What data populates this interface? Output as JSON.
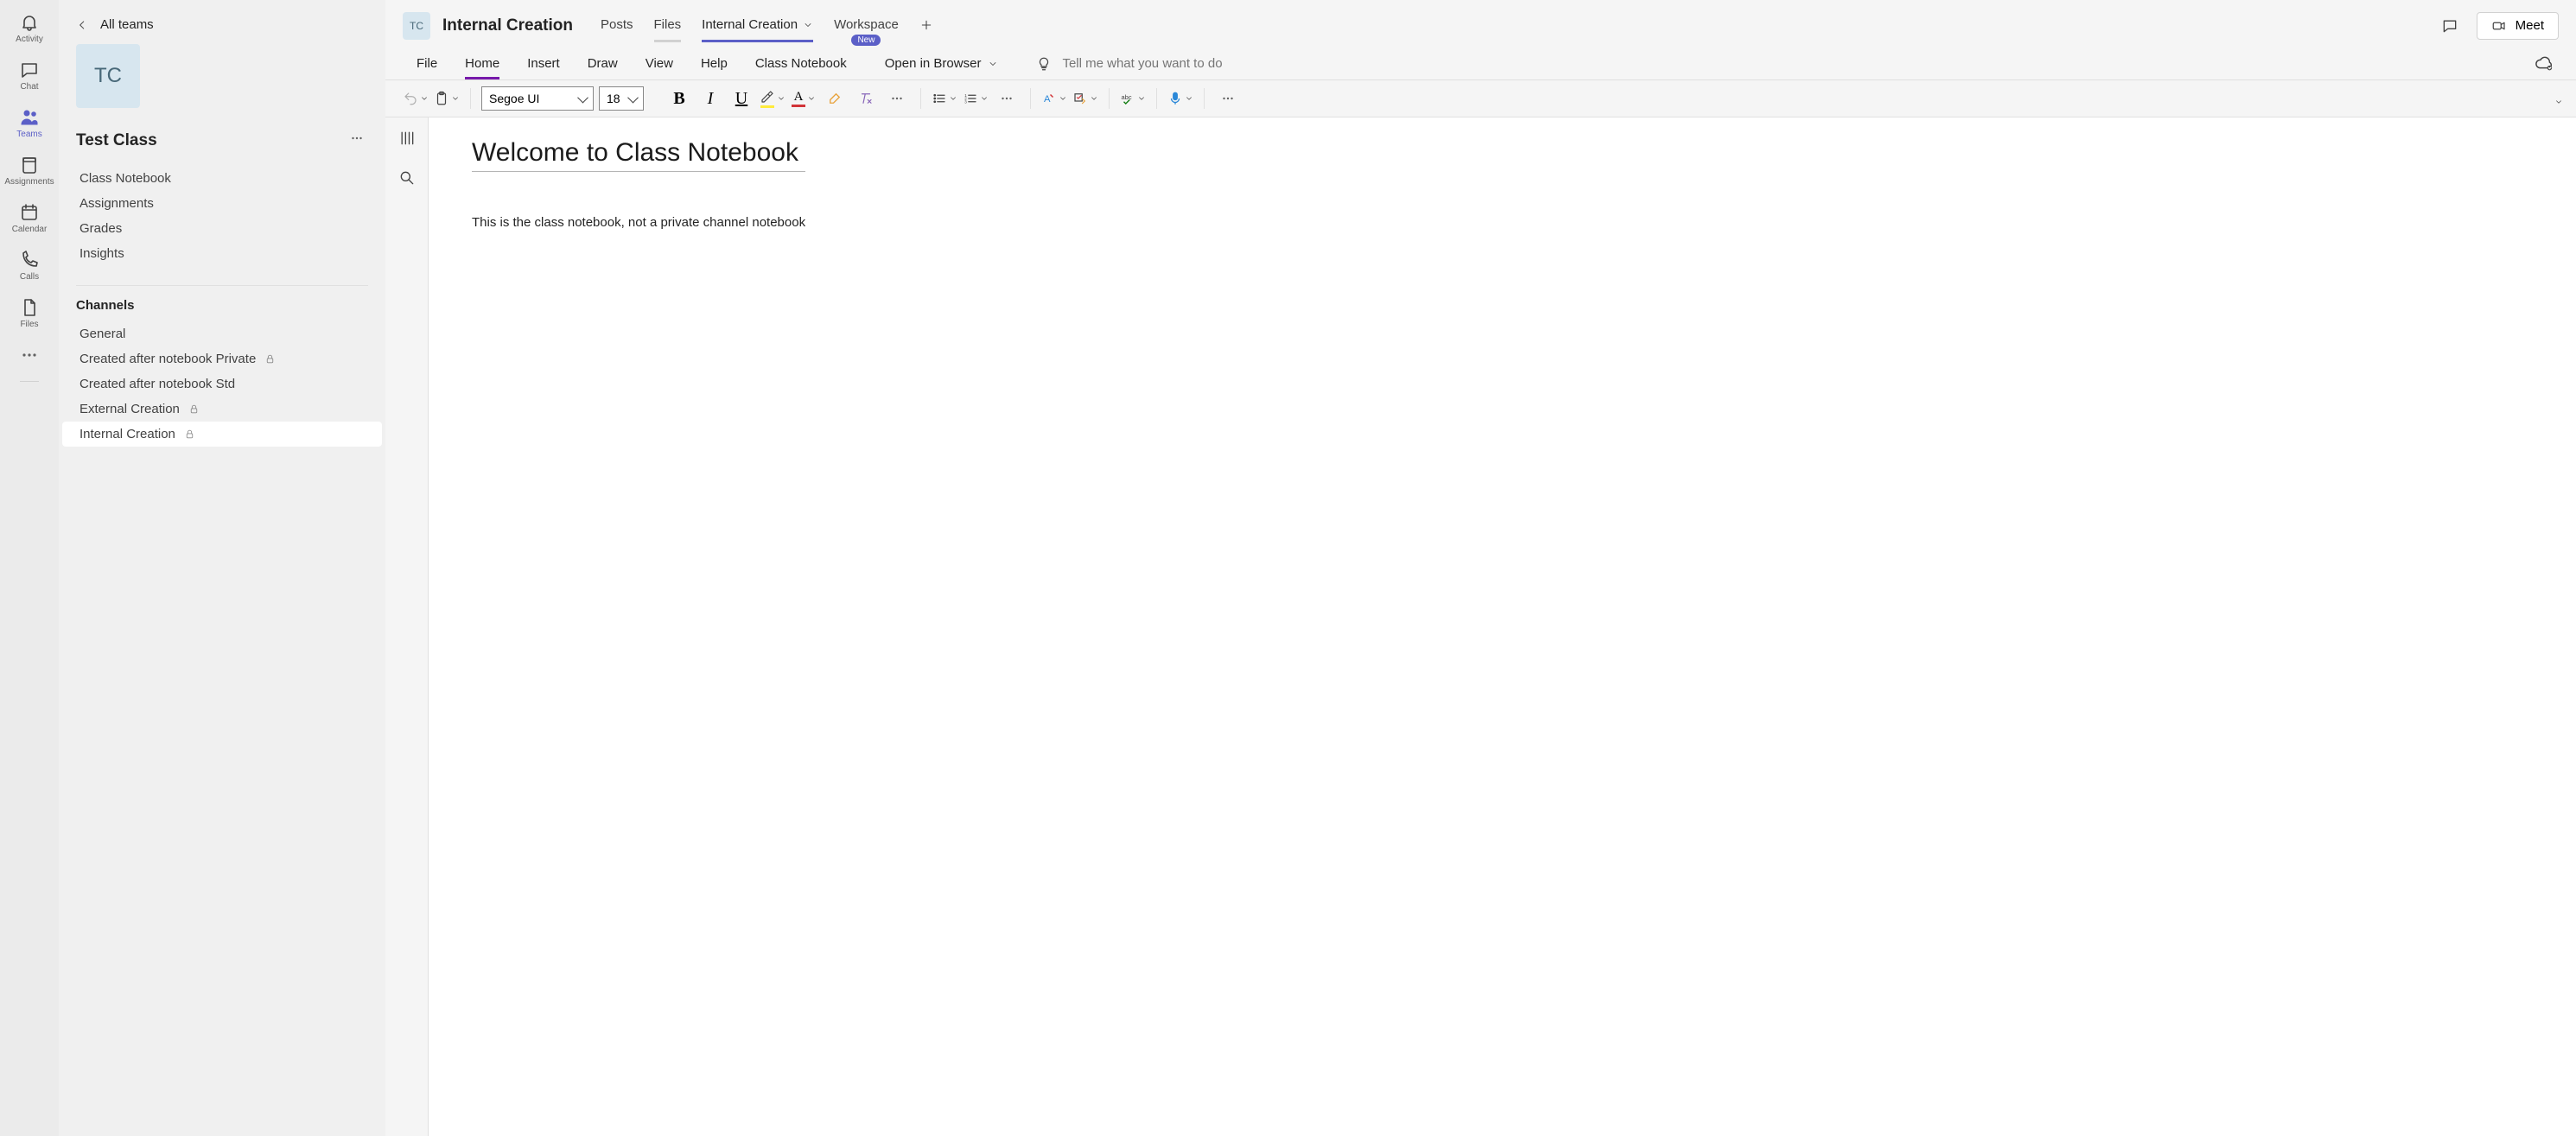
{
  "rail": {
    "items": [
      {
        "label": "Activity"
      },
      {
        "label": "Chat"
      },
      {
        "label": "Teams"
      },
      {
        "label": "Assignments"
      },
      {
        "label": "Calendar"
      },
      {
        "label": "Calls"
      },
      {
        "label": "Files"
      }
    ],
    "active_index": 2
  },
  "left": {
    "all_teams": "All teams",
    "team_initials": "TC",
    "team_name": "Test Class",
    "links": [
      {
        "label": "Class Notebook"
      },
      {
        "label": "Assignments"
      },
      {
        "label": "Grades"
      },
      {
        "label": "Insights"
      }
    ],
    "channels_header": "Channels",
    "channels": [
      {
        "label": "General",
        "private": false
      },
      {
        "label": "Created after notebook Private",
        "private": true
      },
      {
        "label": "Created after notebook Std",
        "private": false
      },
      {
        "label": "External Creation",
        "private": true
      },
      {
        "label": "Internal Creation",
        "private": true
      }
    ],
    "selected_channel_index": 4
  },
  "header": {
    "chip_initials": "TC",
    "channel_title": "Internal Creation",
    "tabs": [
      {
        "label": "Posts"
      },
      {
        "label": "Files"
      },
      {
        "label": "Internal Creation",
        "dropdown": true,
        "active": true
      },
      {
        "label": "Workspace",
        "new_badge": "New"
      }
    ],
    "meet_label": "Meet"
  },
  "ribbon": {
    "tabs": [
      "File",
      "Home",
      "Insert",
      "Draw",
      "View",
      "Help",
      "Class Notebook"
    ],
    "active_index": 1,
    "open_in_browser": "Open in Browser",
    "tell_me_placeholder": "Tell me what you want to do"
  },
  "toolbar": {
    "font_name": "Segoe UI",
    "font_size": "18"
  },
  "notebook": {
    "page_title": "Welcome to Class Notebook",
    "page_body": "This is the class notebook, not a private channel notebook"
  }
}
